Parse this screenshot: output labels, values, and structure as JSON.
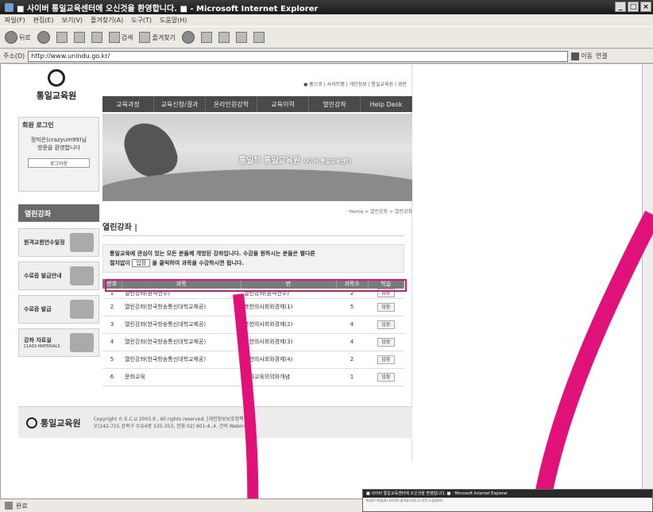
{
  "window": {
    "title": "■ 사이버 통일교육센터에 오신것을 환영합니다. ■ - Microsoft Internet Explorer",
    "controls": [
      "_",
      "□",
      "×"
    ]
  },
  "menu": [
    "파일(F)",
    "편집(E)",
    "보기(V)",
    "즐겨찾기(A)",
    "도구(T)",
    "도움말(H)"
  ],
  "toolbar": {
    "back": "뒤로",
    "search": "검색",
    "favorites": "즐겨찾기"
  },
  "address": {
    "label": "주소(D)",
    "url": "http://www.unindu.go.kr/",
    "go": "이동",
    "links": "연결"
  },
  "site": {
    "logo_text": "통일교육원",
    "top_links": "● 홈으로 | 사이트맵 | 개인정보 | 통일교육원 | 영문",
    "gnb": [
      "교육과정",
      "교육신청/결과",
      "온라인원강학",
      "교육이력",
      "열린강좌",
      "Help Desk"
    ],
    "login": {
      "title": "회원 로그인",
      "greeting_1": "정미은(crazyum99)님",
      "greeting_2": "방문을 환영합니다",
      "logout": "로그아웃"
    },
    "banner": {
      "title": "통일부 통일교육원",
      "subtitle": "사이버 통일교육센터"
    },
    "leftnav": {
      "head": "열린강좌",
      "items": [
        {
          "label": "원격교원연수일정",
          "sub": ""
        },
        {
          "label": "수료증 발급안내",
          "sub": ""
        },
        {
          "label": "수료증 발급",
          "sub": ""
        },
        {
          "label": "강좌 자료실",
          "sub": "CLASS MATERIALS"
        }
      ]
    },
    "content": {
      "breadcrumb": "· Home > 열린강좌 > 열린강좌",
      "title": "열린강좌 |",
      "intro_1": "통일교육에 관심이 있는 모든 분들께 개방된 강좌입니다. 수강을 원하시는 분들은 별다른",
      "intro_2a": "절차없이 ",
      "intro_btn": "입장",
      "intro_2b": " 을 클릭하여 과목을 수강하시면 됩니다.",
      "columns": [
        "번호",
        "과목",
        "반",
        "과목수",
        "학습"
      ],
      "rows": [
        {
          "no": "1",
          "subject": "열린강좌(원격연수)",
          "class": "열린강좌(원격연수)",
          "count": "2",
          "btn": "입장"
        },
        {
          "no": "2",
          "subject": "열린강좌(한국방송통신대학교제공)",
          "class": "북한의사회와경제(1)",
          "count": "5",
          "btn": "입장"
        },
        {
          "no": "3",
          "subject": "열린강좌(한국방송통신대학교제공)",
          "class": "북한의사회와경제(2)",
          "count": "4",
          "btn": "입장"
        },
        {
          "no": "4",
          "subject": "열린강좌(한국방송통신대학교제공)",
          "class": "북한의사회와경제(3)",
          "count": "4",
          "btn": "입장"
        },
        {
          "no": "5",
          "subject": "열린강좌(한국방송통신대학교제공)",
          "class": "북한의사회와경제(4)",
          "count": "2",
          "btn": "입장"
        },
        {
          "no": "6",
          "subject": "문화교육",
          "class": "문화교육의의와개념",
          "count": "1",
          "btn": "입장"
        }
      ]
    },
    "footer": {
      "logo": "통일교육원",
      "line1": "Copyright © E.C.U 2003.9 , All rights reserved. [개인정보보호정책]",
      "line2": "우)142-715 강북구 수유6동 535-353,  전화 02) 901-4..4,  건의 Webmaster"
    }
  },
  "status": {
    "text": "완료"
  },
  "mini_window": {
    "title": "■ 사이버 통일교육센터에 오신것을 환영합니다. ■ - Microsoft Internet Explorer",
    "menu": "파일(F) 편집(E) 보기(V) 즐겨찾기(A) 도구(T) 도움말(H)"
  },
  "colors": {
    "highlight": "#e0127a",
    "gnb": "#4a4a4a"
  }
}
